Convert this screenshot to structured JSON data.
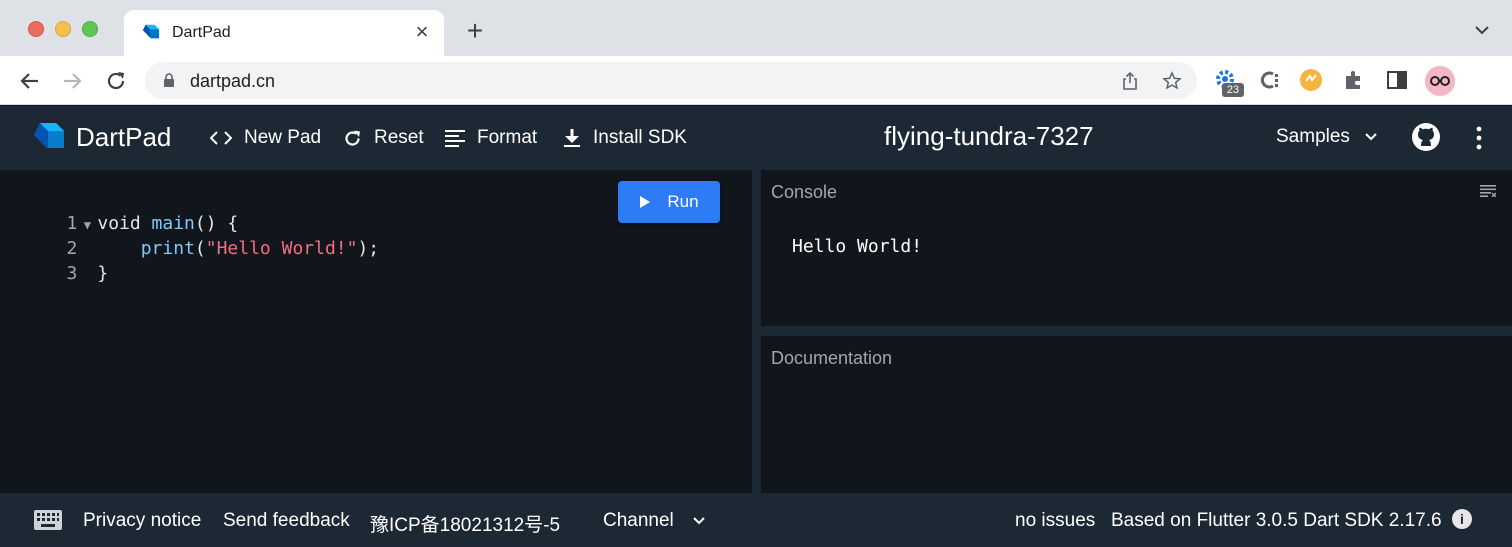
{
  "browser": {
    "tab_title": "DartPad",
    "url": "dartpad.cn",
    "extension_badge": "23"
  },
  "header": {
    "brand": "DartPad",
    "new_pad": "New Pad",
    "reset": "Reset",
    "format": "Format",
    "install_sdk": "Install SDK",
    "pad_name": "flying-tundra-7327",
    "samples": "Samples"
  },
  "editor": {
    "run_label": "Run",
    "lines": [
      {
        "n": "1",
        "tokens": [
          "void ",
          "main",
          "() {"
        ]
      },
      {
        "n": "2",
        "tokens": [
          "    ",
          "print",
          "(",
          "\"Hello World!\"",
          ");"
        ]
      },
      {
        "n": "3",
        "tokens": [
          "}"
        ]
      }
    ]
  },
  "console": {
    "title": "Console",
    "output": "Hello World!"
  },
  "documentation": {
    "title": "Documentation"
  },
  "footer": {
    "privacy": "Privacy notice",
    "feedback": "Send feedback",
    "icp": "豫ICP备18021312号-5",
    "channel": "Channel",
    "issues": "no issues",
    "sdk_info": "Based on Flutter 3.0.5 Dart SDK 2.17.6"
  },
  "colors": {
    "header_bg": "#1c2834",
    "editor_bg": "#11151c",
    "run_button": "#2d7cf6",
    "string": "#f26f7e",
    "function": "#7ccafc"
  }
}
